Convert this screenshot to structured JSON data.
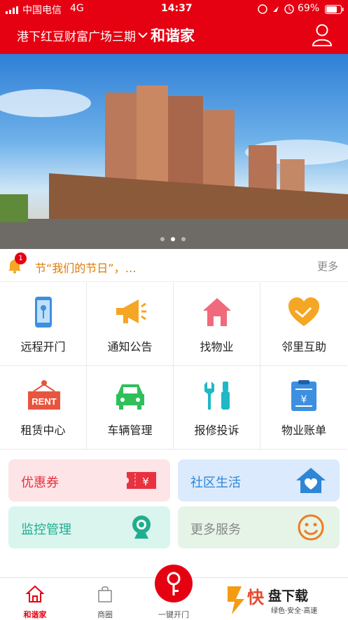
{
  "status_bar": {
    "carrier": "中国电信",
    "network": "4G",
    "time": "14:37",
    "battery": "69%"
  },
  "header": {
    "location": "港下红豆财富广场三期",
    "brand": "和谐家"
  },
  "banner": {
    "page_indicator": {
      "count": 3,
      "active": 2
    }
  },
  "notice": {
    "badge": "1",
    "text": "节“我们的节日”，…",
    "more": "更多"
  },
  "services": [
    {
      "label": "远程开门",
      "icon": "phone-key-icon"
    },
    {
      "label": "通知公告",
      "icon": "megaphone-icon"
    },
    {
      "label": "找物业",
      "icon": "house-icon"
    },
    {
      "label": "邻里互助",
      "icon": "heart-hands-icon"
    },
    {
      "label": "租赁中心",
      "icon": "rent-sign-icon",
      "sign_text": "RENT"
    },
    {
      "label": "车辆管理",
      "icon": "car-icon"
    },
    {
      "label": "报修投诉",
      "icon": "tools-icon"
    },
    {
      "label": "物业账单",
      "icon": "bill-icon",
      "sign_text": "¥"
    }
  ],
  "cards": [
    {
      "label": "优惠券",
      "icon": "ticket-icon",
      "sign_text": "¥",
      "bg": "#fde4e6",
      "color": "#e8323f"
    },
    {
      "label": "社区生活",
      "icon": "home-heart-icon",
      "bg": "#dbeafc",
      "color": "#2d86d6"
    },
    {
      "label": "监控管理",
      "icon": "camera-icon",
      "bg": "#d9f5ee",
      "color": "#1fae8e"
    },
    {
      "label": "更多服务",
      "icon": "smiley-icon",
      "bg": "#e6f4e8",
      "color": "#888888"
    }
  ],
  "tabbar": {
    "home": "和谐家",
    "mall": "商圈",
    "unlock": "一键开门"
  },
  "watermark": {
    "brand": "快盘下载",
    "slogan": "绿色·安全·高速"
  },
  "colors": {
    "primary": "#e50012",
    "text": "#222222"
  }
}
